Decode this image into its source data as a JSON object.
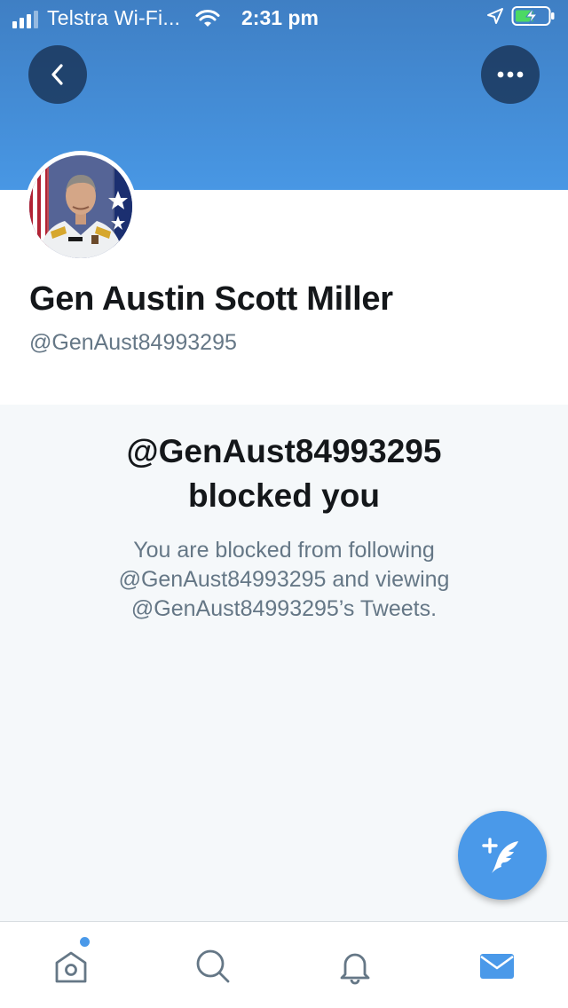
{
  "status_bar": {
    "carrier": "Telstra Wi-Fi...",
    "time": "2:31 pm",
    "icons": [
      "signal-icon",
      "wifi-icon",
      "location-arrow-icon",
      "battery-charging-icon"
    ]
  },
  "header": {
    "back_icon": "chevron-left-icon",
    "more_icon": "more-dots-icon",
    "banner_color": "#4897e4"
  },
  "profile": {
    "name": "Gen Austin Scott Miller",
    "handle": "@GenAust84993295"
  },
  "blocked": {
    "title": "@GenAust84993295\nblocked you",
    "description": "You are blocked from following\n@GenAust84993295 and viewing\n@GenAust84993295’s Tweets."
  },
  "fab": {
    "icon": "compose-tweet-icon",
    "color": "#4a99e9"
  },
  "tab_bar": {
    "tabs": [
      {
        "name": "home",
        "icon": "home-icon",
        "badge_dot": true
      },
      {
        "name": "search",
        "icon": "search-icon"
      },
      {
        "name": "notifications",
        "icon": "bell-icon"
      },
      {
        "name": "messages",
        "icon": "mail-icon",
        "active": true
      }
    ],
    "accent": "#4a99e9"
  }
}
